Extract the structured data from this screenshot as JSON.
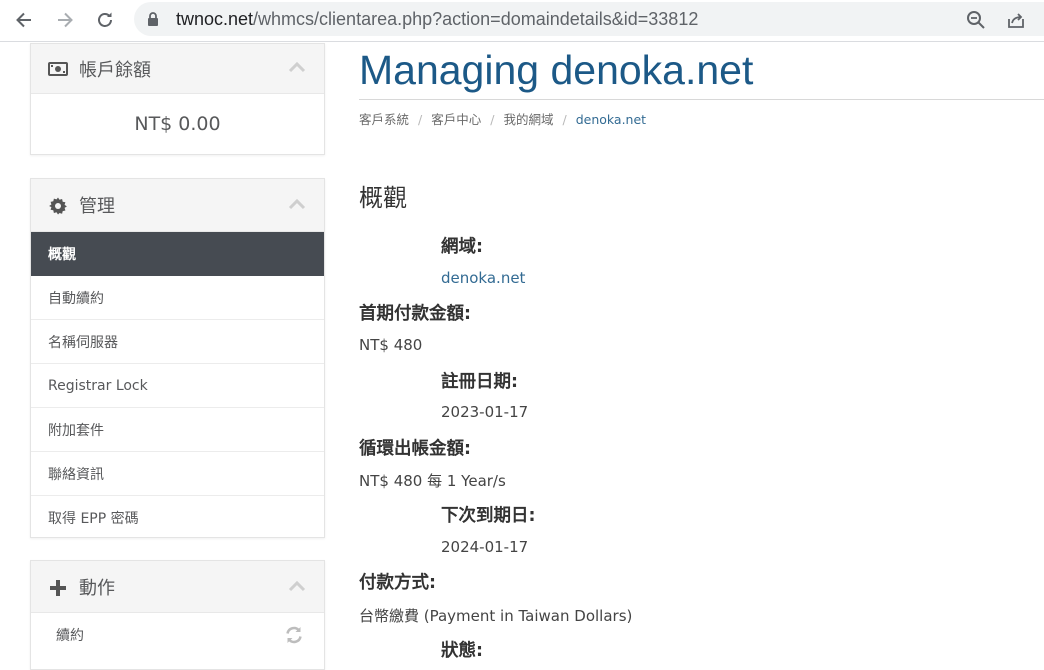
{
  "browser": {
    "url_host": "twnoc.net",
    "url_path": "/whmcs/clientarea.php?action=domaindetails&id=33812"
  },
  "sidebar": {
    "balance_panel": {
      "title": "帳戶餘額",
      "amount": "NT$ 0.00"
    },
    "manage_panel": {
      "title": "管理",
      "items": [
        {
          "label": "概觀",
          "active": true
        },
        {
          "label": "自動續約"
        },
        {
          "label": "名稱伺服器"
        },
        {
          "label": "Registrar Lock"
        },
        {
          "label": "附加套件"
        },
        {
          "label": "聯絡資訊"
        },
        {
          "label": "取得 EPP 密碼"
        }
      ]
    },
    "actions_panel": {
      "title": "動作",
      "items": [
        {
          "label": "續約"
        }
      ]
    }
  },
  "main": {
    "title": "Managing denoka.net",
    "breadcrumb": [
      "客戶系統",
      "客戶中心",
      "我的網域",
      "denoka.net"
    ],
    "section_title": "概觀",
    "fields": {
      "domain_label": "網域:",
      "domain_value": "denoka.net",
      "first_payment_label": "首期付款金額:",
      "first_payment_value": "NT$ 480",
      "registration_label": "註冊日期:",
      "registration_value": "2023-01-17",
      "recurring_label": "循環出帳金額:",
      "recurring_value": "NT$ 480 每 1 Year/s",
      "next_due_label": "下次到期日:",
      "next_due_value": "2024-01-17",
      "payment_method_label": "付款方式:",
      "payment_method_value": "台幣繳費 (Payment in Taiwan Dollars)",
      "status_label": "狀態:"
    }
  },
  "colors": {
    "accent": "#1c5987",
    "active_menu_bg": "#464b52",
    "link": "#336b93"
  }
}
